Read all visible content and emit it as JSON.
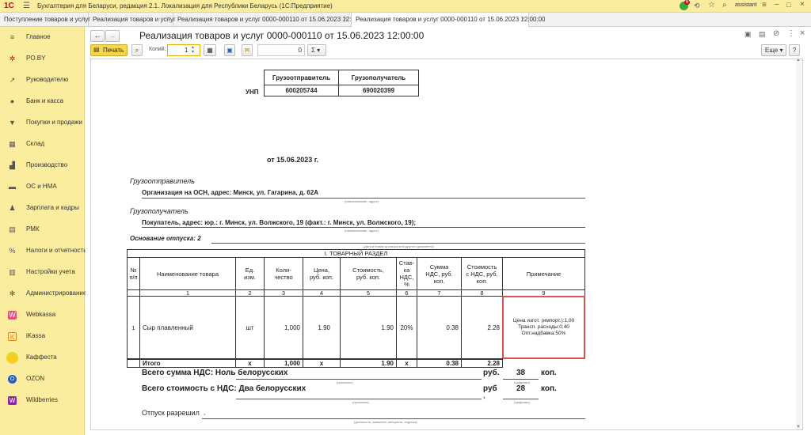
{
  "app": {
    "logo": "1С",
    "title": "Бухгалтерия для Беларуси, редакция 2.1. Локализация для Республики Беларусь    (1С:Предприятие)",
    "badge": "6",
    "user": "assistant"
  },
  "tabs": [
    "Поступление товаров и услуг",
    "Реализация товаров и услуг",
    "Реализация товаров и услуг 0000-000110 от 15.06.2023 12:00:00",
    "Реализация товаров и услуг 0000-000110 от 15.06.2023 12:00:00"
  ],
  "sidebar": [
    "Главное",
    "PO.BY",
    "Руководителю",
    "Банк и касса",
    "Покупки и продажи",
    "Склад",
    "Производство",
    "ОС и НМА",
    "Зарплата и кадры",
    "РМК",
    "Налоги и отчетность",
    "Настройки учета",
    "Администрирование",
    "Webkassa",
    "iKassa",
    "Каффеста",
    "OZON",
    "Wildberries"
  ],
  "doc_title": "Реализация товаров и услуг 0000-000110 от 15.06.2023 12:00:00",
  "toolbar": {
    "print": "Печать",
    "copies_label": "Копий:",
    "copies": "1",
    "sum": "0",
    "sigma": "Σ",
    "more": "Еще"
  },
  "unp": {
    "label": "УНП",
    "sender_h": "Грузоотправитель",
    "receiver_h": "Грузополучатель",
    "sender": "600205744",
    "receiver": "690020399"
  },
  "date_line": "от 15.06.2023 г.",
  "shipper": {
    "label": "Грузоотправитель",
    "value": "Организация на ОСН, адрес:  Минск, ул. Гагарина, д. 62А",
    "note": "(наименование, адрес)"
  },
  "consignee": {
    "label": "Грузополучатель",
    "value": "Покупатель, адрес: юр.: г. Минск, ул. Волжского, 19 (факт.: г. Минск, ул. Волжского, 19);",
    "note": "(наименование, адрес)"
  },
  "basis": {
    "label": "Основание отпуска: 2",
    "note": "(дата и номер договора или другого документа)"
  },
  "section": "I. ТОВАРНЫЙ РАЗДЕЛ",
  "headers": [
    "№ п/п",
    "Наименование товара",
    "Ед. изм.",
    "Коли-чество",
    "Цена, руб. коп.",
    "Стоимость, руб. коп.",
    "Став-ка НДС, %",
    "Сумма НДС, руб. коп.",
    "Стоимость с НДС, руб. коп.",
    "Примечание"
  ],
  "col_nums": [
    "1",
    "2",
    "3",
    "4",
    "5",
    "6",
    "7",
    "8",
    "9"
  ],
  "row": {
    "n": "1",
    "name": "Сыр плавленный",
    "unit": "шт",
    "qty": "1,000",
    "price": "1.90",
    "cost": "1.90",
    "rate": "20%",
    "vat": "0.38",
    "total": "2.28",
    "note1": "Цена изгот. (импорт.):1,00",
    "note2": "Трансп. расходы:0,40",
    "note3": "Опт.надбавка:50%"
  },
  "itogo": {
    "label": "Итого",
    "x1": "x",
    "qty": "1,000",
    "x2": "x",
    "cost": "1.90",
    "x3": "x",
    "vat": "0.38",
    "total": "2.28"
  },
  "vat_sum": {
    "label": "Всего сумма НДС: Ноль белорусских",
    "rub": "руб.",
    "rub_n": "38",
    "kop": "коп.",
    "note_l": "(прописью)",
    "note_r": "(цифрами)"
  },
  "total_sum": {
    "label": "Всего стоимость с НДС: Два белорусских",
    "rub": "руб",
    "rub_n": "28",
    "kop": "коп.",
    "note_l": "(прописью)",
    "note_r": "(цифрами)",
    "comma": ","
  },
  "release": {
    "label": "Отпуск разрешил",
    "comma": ",",
    "note": "(должность, фамилия, инициалы, подпись)"
  },
  "colors": {
    "titlebar": "#fbed9e",
    "sidebar": "#fbed9e",
    "print": "#f7d64a",
    "highlight": "#d9534f"
  }
}
